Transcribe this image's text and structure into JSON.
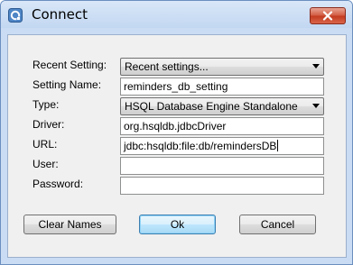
{
  "window": {
    "title": "Connect",
    "icon": "connect-app-icon",
    "close_icon": "close-icon"
  },
  "form": {
    "recent_setting": {
      "label": "Recent Setting:",
      "value": "Recent settings..."
    },
    "setting_name": {
      "label": "Setting Name:",
      "value": "reminders_db_setting"
    },
    "type": {
      "label": "Type:",
      "value": "HSQL Database Engine Standalone"
    },
    "driver": {
      "label": "Driver:",
      "value": "org.hsqldb.jdbcDriver"
    },
    "url": {
      "label": "URL:",
      "value": "jdbc:hsqldb:file:db/remindersDB"
    },
    "user": {
      "label": "User:",
      "value": ""
    },
    "password": {
      "label": "Password:",
      "value": ""
    }
  },
  "buttons": {
    "clear_names": "Clear Names",
    "ok": "Ok",
    "cancel": "Cancel"
  },
  "colors": {
    "frame": "#c9dcf3",
    "close_button": "#c23a1f",
    "default_button_border": "#3c7fb1"
  }
}
